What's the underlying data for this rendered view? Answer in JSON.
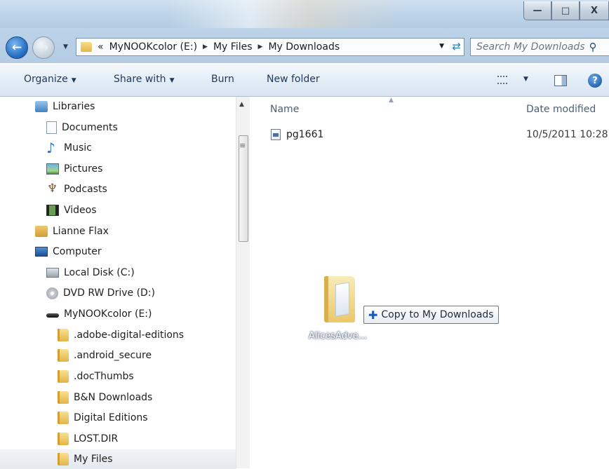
{
  "window": {
    "controls": {
      "minimize": "—",
      "maximize": "□",
      "close": "X"
    }
  },
  "nav": {
    "back_icon": "back-arrow-icon",
    "forward_icon": "forward-arrow-icon",
    "breadcrumb_prefix": "«",
    "breadcrumb": [
      "MyNOOKcolor (E:)",
      "My Files",
      "My Downloads"
    ],
    "search_placeholder": "Search My Downloads"
  },
  "toolbar": {
    "organize": "Organize",
    "share_with": "Share with",
    "burn": "Burn",
    "new_folder": "New folder"
  },
  "tree": [
    {
      "label": "Libraries",
      "icon": "libraries-icon"
    },
    {
      "label": "Documents",
      "icon": "documents-icon"
    },
    {
      "label": "Music",
      "icon": "music-icon"
    },
    {
      "label": "Pictures",
      "icon": "pictures-icon"
    },
    {
      "label": "Podcasts",
      "icon": "podcasts-icon"
    },
    {
      "label": "Videos",
      "icon": "videos-icon"
    },
    {
      "label": "Lianne Flax",
      "icon": "user-folder-icon"
    },
    {
      "label": "Computer",
      "icon": "computer-icon"
    },
    {
      "label": "Local Disk (C:)",
      "icon": "local-disk-icon"
    },
    {
      "label": "DVD RW Drive (D:)",
      "icon": "dvd-drive-icon"
    },
    {
      "label": "MyNOOKcolor (E:)",
      "icon": "removable-drive-icon"
    },
    {
      "label": ".adobe-digital-editions",
      "icon": "folder-icon"
    },
    {
      "label": ".android_secure",
      "icon": "folder-icon"
    },
    {
      "label": ".docThumbs",
      "icon": "folder-icon"
    },
    {
      "label": "B&N Downloads",
      "icon": "folder-icon"
    },
    {
      "label": "Digital Editions",
      "icon": "folder-icon"
    },
    {
      "label": "LOST.DIR",
      "icon": "folder-icon"
    },
    {
      "label": "My Files",
      "icon": "folder-icon"
    }
  ],
  "content": {
    "columns": {
      "name": "Name",
      "date_modified": "Date modified"
    },
    "files": [
      {
        "name": "pg1661",
        "date": "10/5/2011 10:28"
      }
    ],
    "drag": {
      "label": "AlicesAdve...",
      "tooltip": "Copy to My Downloads",
      "tooltip_icon": "plus-icon"
    }
  }
}
